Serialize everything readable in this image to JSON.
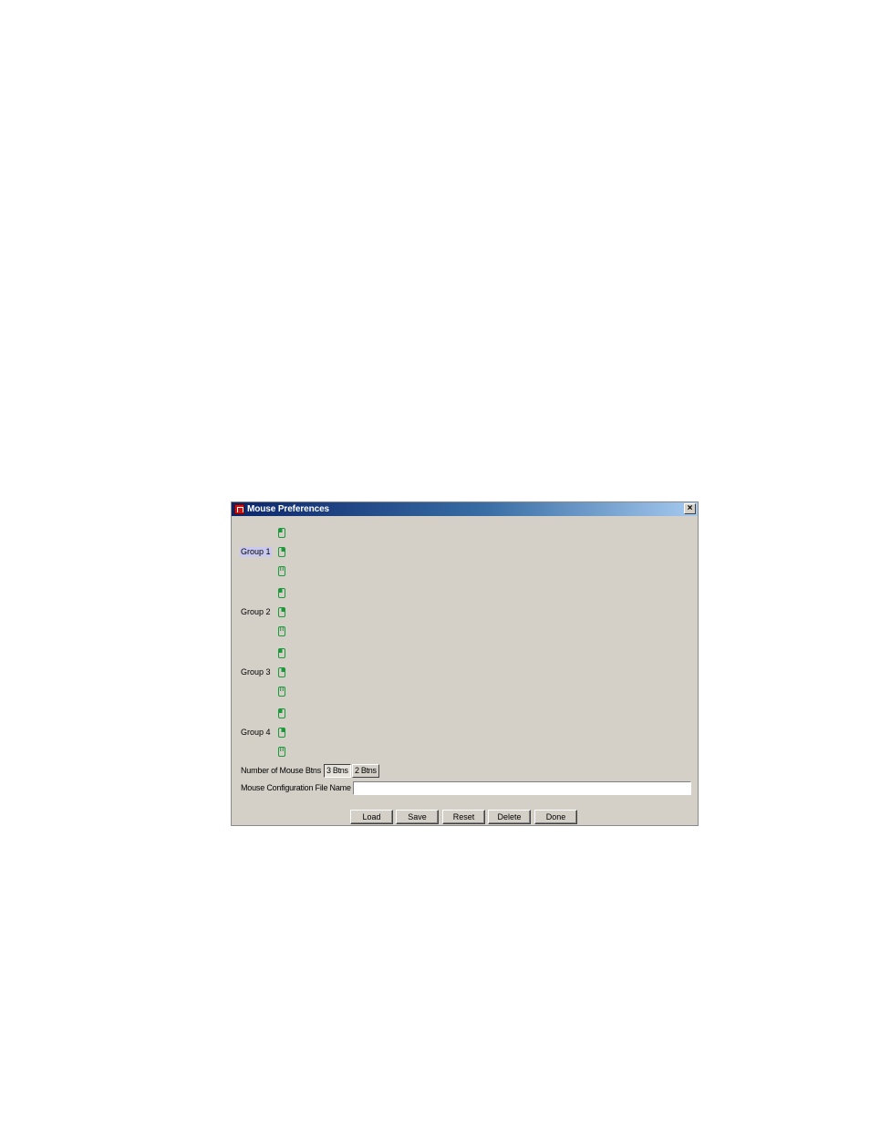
{
  "window": {
    "title": "Mouse Preferences",
    "close_label": "×"
  },
  "groups": [
    {
      "label": "Group 1",
      "selected": true,
      "icons": [
        "mouse-left-button-icon",
        "mouse-right-button-icon",
        "mouse-middle-button-icon"
      ]
    },
    {
      "label": "Group 2",
      "selected": false,
      "icons": [
        "mouse-left-button-icon",
        "mouse-right-button-icon",
        "mouse-middle-button-icon"
      ]
    },
    {
      "label": "Group 3",
      "selected": false,
      "icons": [
        "mouse-left-button-icon",
        "mouse-right-button-icon",
        "mouse-middle-button-icon"
      ]
    },
    {
      "label": "Group 4",
      "selected": false,
      "icons": [
        "mouse-left-button-icon",
        "mouse-right-button-icon",
        "mouse-middle-button-icon"
      ]
    }
  ],
  "mouse_buttons": {
    "label": "Number of Mouse Btns",
    "options": [
      "3 Btns",
      "2 Btns"
    ],
    "selected": "3 Btns"
  },
  "config_file": {
    "label": "Mouse Configuration File Name",
    "value": ""
  },
  "footer": {
    "load": "Load",
    "save": "Save",
    "reset": "Reset",
    "delete": "Delete",
    "done": "Done"
  },
  "colors": {
    "window_bg": "#d4d0c8",
    "icon_green": "#1a9a3a",
    "selection_bg": "#c8c8f0"
  }
}
